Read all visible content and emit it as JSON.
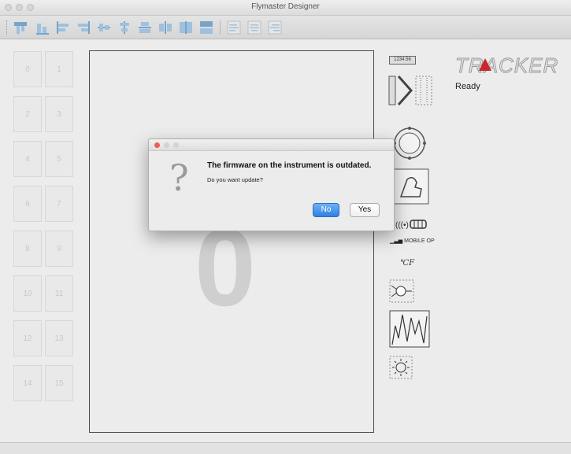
{
  "window": {
    "title": "Flymaster Designer"
  },
  "toolbar": {
    "icons": [
      "align-left-icon",
      "align-bottom-left-icon",
      "align-bottom-icon",
      "align-right-icon",
      "center-horizontal-icon",
      "center-vertical-icon",
      "align-top-icon",
      "align-middle-icon",
      "equal-width-icon",
      "equal-height-icon",
      "text-left-icon",
      "text-center-icon",
      "text-right-icon"
    ]
  },
  "slots": [
    "0",
    "1",
    "2",
    "3",
    "4",
    "5",
    "6",
    "7",
    "8",
    "9",
    "10",
    "11",
    "12",
    "13",
    "14",
    "15"
  ],
  "canvas": {
    "page_number": "0"
  },
  "palette": {
    "numeric_value": "1234.56",
    "mobile_label": "MOBILE OP"
  },
  "tracker": {
    "logo_text": "TRACKER",
    "status": "Ready",
    "accent_color": "#c9272d"
  },
  "dialog": {
    "message": "The firmware on the instrument is outdated.",
    "informative": "Do you want update?",
    "no_label": "No",
    "yes_label": "Yes",
    "close_color": "#ec5e57"
  }
}
